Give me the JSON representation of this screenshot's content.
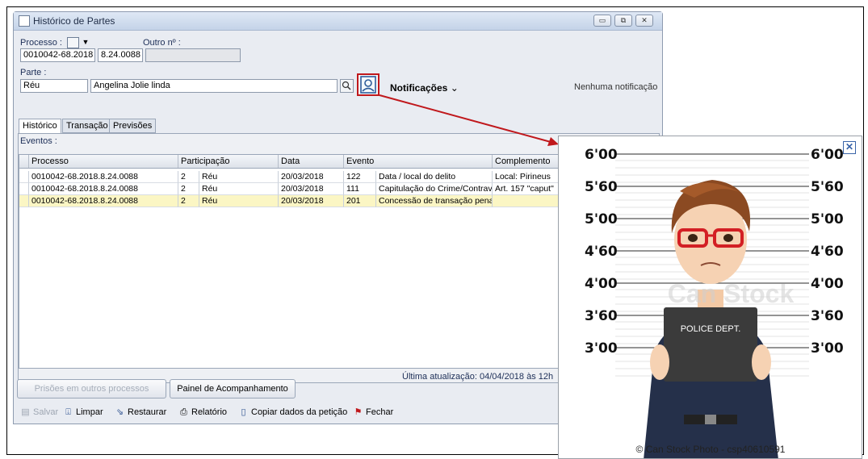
{
  "window": {
    "title": "Histórico de Partes",
    "controls": [
      "▭",
      "⧉",
      "✕"
    ]
  },
  "processo": {
    "label": "Processo :",
    "number_part1": "0010042-68.2018",
    "number_part2": "8.24.0088",
    "outro_label": "Outro nº :",
    "outro_value": ""
  },
  "parte": {
    "label": "Parte :",
    "type": "Réu",
    "name": "Angelina Jolie linda",
    "notificacoes_label": "Notificações",
    "nenhuma": "Nenhuma notificação"
  },
  "tabs": [
    "Histórico",
    "Transação",
    "Previsões"
  ],
  "eventos": {
    "label": "Eventos :",
    "columns": [
      "Processo",
      "Participação",
      "Data",
      "Evento",
      "Complemento"
    ],
    "rows": [
      {
        "processo": "0010042-68.2018.8.24.0088",
        "part_num": "2",
        "part": "Réu",
        "data": "20/03/2018",
        "ev_code": "122",
        "ev_desc": "Data / local do delito",
        "complemento": "Local: Pirineus"
      },
      {
        "processo": "0010042-68.2018.8.24.0088",
        "part_num": "2",
        "part": "Réu",
        "data": "20/03/2018",
        "ev_code": "111",
        "ev_desc": "Capitulação do Crime/Contrav",
        "complemento": "Art. 157 \"caput\""
      },
      {
        "processo": "0010042-68.2018.8.24.0088",
        "part_num": "2",
        "part": "Réu",
        "data": "20/03/2018",
        "ev_code": "201",
        "ev_desc": "Concessão de transação pena",
        "complemento": ""
      }
    ],
    "last_update": "Última atualização:  04/04/2018 às 12h"
  },
  "buttons": {
    "prisoes": "Prisões em outros processos",
    "painel": "Painel de Acompanhamento"
  },
  "toolbar": {
    "salvar": "Salvar",
    "limpar": "Limpar",
    "restaurar": "Restaurar",
    "relatorio": "Relatório",
    "copiar": "Copiar dados da petição",
    "fechar": "Fechar"
  },
  "popup": {
    "heights": [
      "6'00",
      "5'60",
      "5'00",
      "4'60",
      "4'00",
      "3'60",
      "3'00"
    ],
    "sign_text": "POLICE DEPT.",
    "watermark": "Can Stock",
    "credit": "© Can Stock Photo - csp40610591",
    "close": "✕"
  },
  "colors": {
    "selected_row": "#fbf6c4",
    "arrow": "#c0181c",
    "accent": "#1c2e57"
  }
}
